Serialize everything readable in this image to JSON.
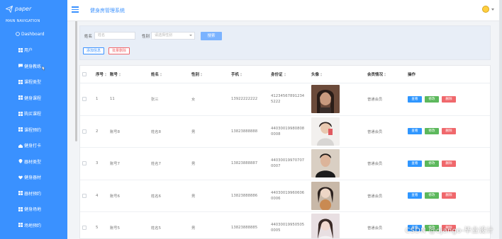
{
  "sidebar": {
    "brand": "paper",
    "heading": "MAIN NAVIGATION",
    "items": [
      {
        "label": "Dashboard",
        "icon": "home-icon"
      },
      {
        "label": "用户",
        "icon": "grid-icon"
      },
      {
        "label": "健身教练",
        "icon": "comment-icon"
      },
      {
        "label": "课程类型",
        "icon": "grid-icon"
      },
      {
        "label": "健身课程",
        "icon": "grid-icon"
      },
      {
        "label": "购买课程",
        "icon": "grid-icon"
      },
      {
        "label": "课程预约",
        "icon": "grid-icon"
      },
      {
        "label": "健身打卡",
        "icon": "checkin-icon"
      },
      {
        "label": "器材类型",
        "icon": "pin-icon"
      },
      {
        "label": "健身器材",
        "icon": "heart-icon"
      },
      {
        "label": "器材预约",
        "icon": "grid-icon"
      },
      {
        "label": "健身场地",
        "icon": "grid-icon"
      },
      {
        "label": "场地预约",
        "icon": "grid-icon"
      }
    ]
  },
  "header": {
    "title": "健身房管理系统"
  },
  "filter": {
    "name_label": "姓名",
    "name_placeholder": "姓名",
    "gender_label": "性别",
    "gender_placeholder": "请选择性别",
    "search_label": "搜索",
    "add_label": "添加信息",
    "batch_delete_label": "批量删除"
  },
  "table": {
    "headers": [
      "序号",
      "账号",
      "姓名",
      "性别",
      "手机",
      "身份证",
      "头像",
      "会员情况",
      "操作"
    ],
    "actions": {
      "view": "查看",
      "edit": "修改",
      "delete": "删除"
    },
    "rows": [
      {
        "index": "1",
        "account": "11",
        "name": "张三",
        "gender": "女",
        "phone": "13922222222",
        "id_card": "412345678912345222",
        "member": "普通会员"
      },
      {
        "index": "2",
        "account": "账号8",
        "name": "姓名8",
        "gender": "男",
        "phone": "13823888888",
        "id_card": "440300199808080008",
        "member": "普通会员"
      },
      {
        "index": "3",
        "account": "账号7",
        "name": "姓名7",
        "gender": "男",
        "phone": "13823888887",
        "id_card": "440300199707070007",
        "member": "普通会员"
      },
      {
        "index": "4",
        "account": "账号6",
        "name": "姓名6",
        "gender": "男",
        "phone": "13823888886",
        "id_card": "440300199606060006",
        "member": "普通会员"
      },
      {
        "index": "5",
        "account": "账号5",
        "name": "姓名5",
        "gender": "男",
        "phone": "13823888885",
        "id_card": "440300199505050005",
        "member": "普通会员"
      }
    ]
  },
  "watermark": "CSDN @django-毕业设计",
  "colors": {
    "accent": "#3a91ff",
    "view": "#2f96ff",
    "edit": "#5cb85c",
    "delete": "#f0686c"
  }
}
